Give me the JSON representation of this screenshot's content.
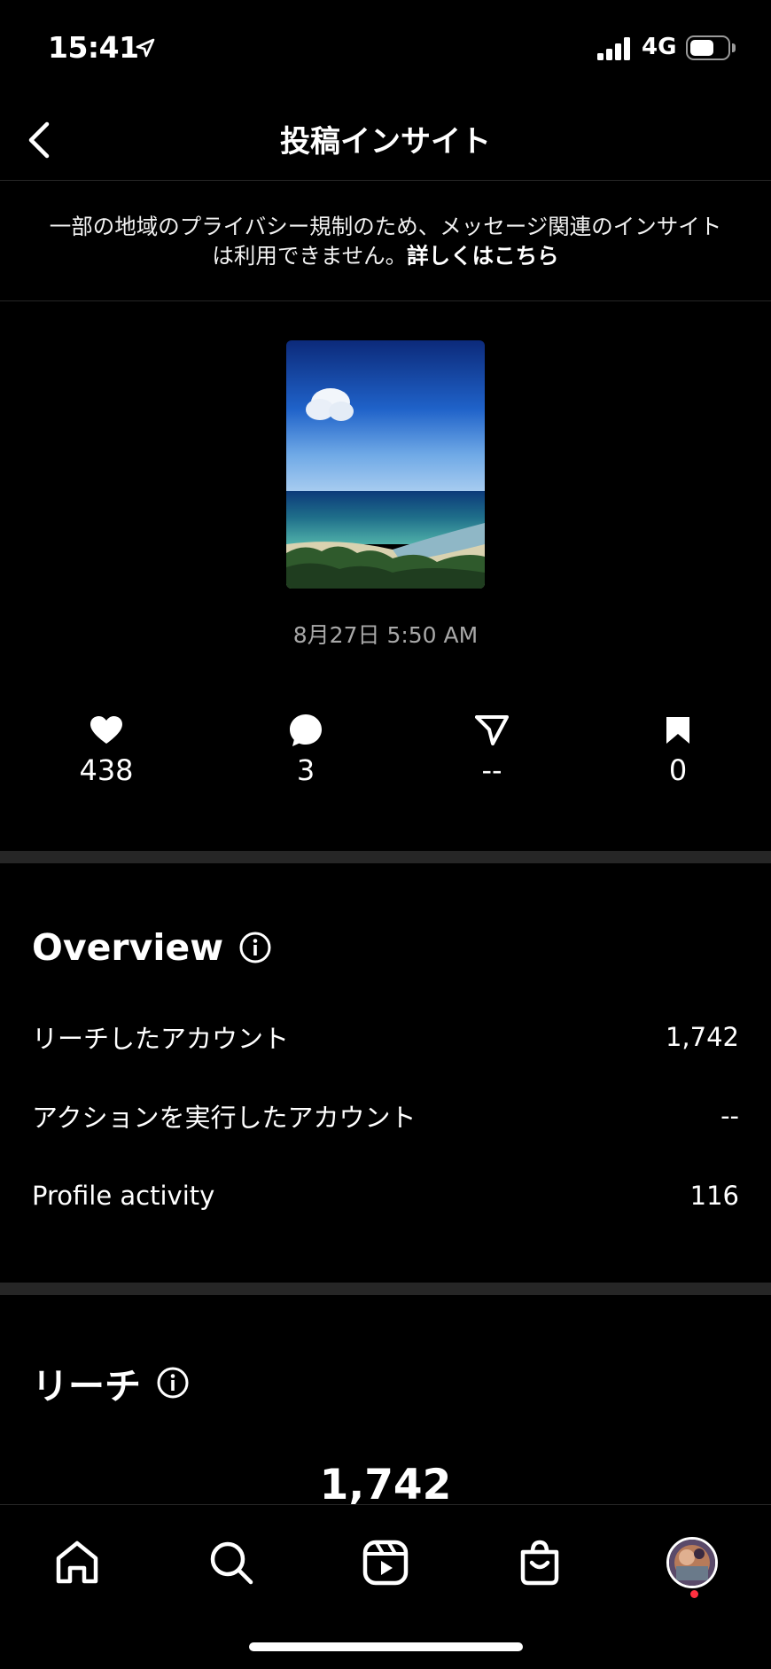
{
  "status_bar": {
    "time": "15:41",
    "network": "4G",
    "battery_level": 0.7
  },
  "header": {
    "title": "投稿インサイト"
  },
  "privacy_notice": {
    "text": "一部の地域のプライバシー規制のため、メッセージ関連のインサイトは利用できません。",
    "link": "詳しくはこちら"
  },
  "post": {
    "date": "8月27日 5:50 AM"
  },
  "metrics": [
    {
      "icon": "heart-icon",
      "value": "438"
    },
    {
      "icon": "comment-icon",
      "value": "3"
    },
    {
      "icon": "share-icon",
      "value": "--"
    },
    {
      "icon": "save-icon",
      "value": "0"
    }
  ],
  "overview": {
    "title": "Overview",
    "rows": [
      {
        "label": "リーチしたアカウント",
        "value": "1,742"
      },
      {
        "label": "アクションを実行したアカウント",
        "value": "--"
      },
      {
        "label": "Profile activity",
        "value": "116"
      }
    ]
  },
  "reach": {
    "title": "リーチ",
    "value": "1,742"
  },
  "tab_bar": {
    "items": [
      "home-icon",
      "search-icon",
      "reels-icon",
      "shop-icon",
      "profile-avatar"
    ]
  }
}
